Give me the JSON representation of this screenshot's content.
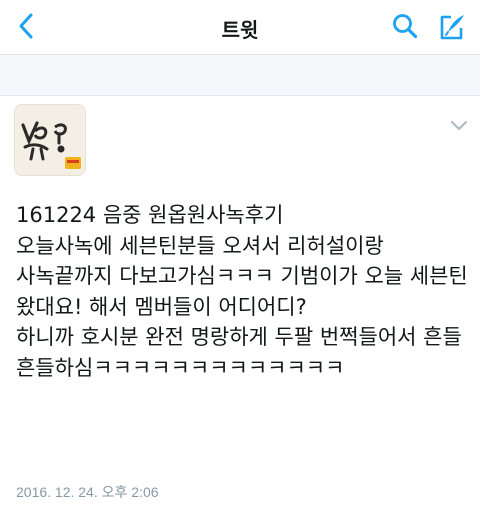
{
  "header": {
    "title": "트윗",
    "back_icon": "chevron-left-icon",
    "search_icon": "search-icon",
    "compose_icon": "compose-tweet-icon",
    "accent_color": "#1da1f2"
  },
  "tweet": {
    "text": "161224 음중 원옵원사녹후기\n오늘사녹에 세븐틴분들 오셔서 리허설이랑\n사녹끝까지 다보고가심ㅋㅋㅋ 기범이가 오늘 세븐틴 왔대요! 해서 멤버들이 어디어디?\n하니까 호시분 완전 명랑하게 두팔 번쩍들어서 흔들흔들하심ㅋㅋㅋㅋㅋㅋㅋㅋㅋㅋㅋㅋㅋ",
    "timestamp": "2016. 12. 24. 오후 2:06",
    "more_icon": "chevron-down-icon",
    "avatar_icon": "avatar"
  }
}
